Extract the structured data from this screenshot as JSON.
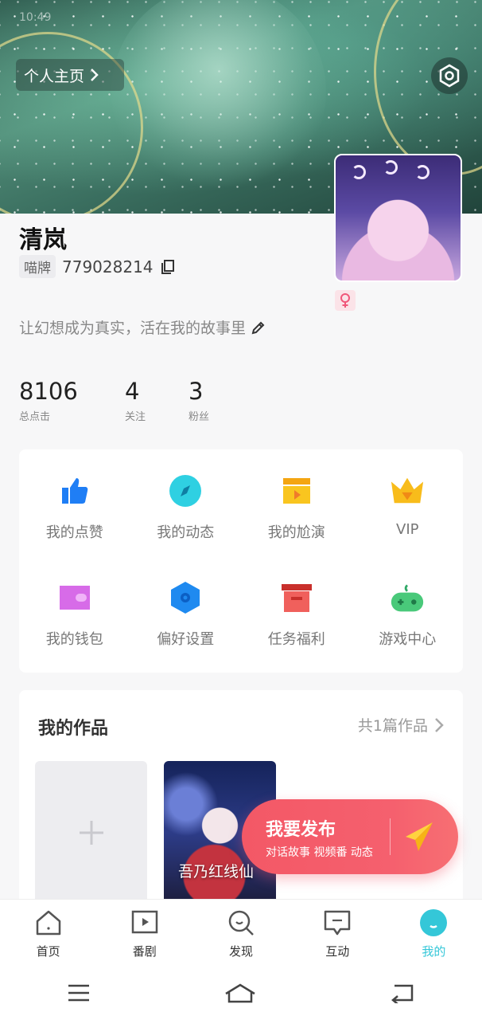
{
  "header": {
    "profile_link_label": "个人主页",
    "status_time": "10:49"
  },
  "user": {
    "name": "清岚",
    "id_tag": "喵牌",
    "id_number": "779028214",
    "bio": "让幻想成为真实，活在我的故事里",
    "gender": "female"
  },
  "stats": [
    {
      "value": "8106",
      "label": "总点击"
    },
    {
      "value": "4",
      "label": "关注"
    },
    {
      "value": "3",
      "label": "粉丝"
    }
  ],
  "menu": [
    {
      "label": "我的点赞",
      "icon": "thumbs-up-icon",
      "color": "#1f7ef5"
    },
    {
      "label": "我的动态",
      "icon": "compass-icon",
      "color": "#2fd0e2"
    },
    {
      "label": "我的尬演",
      "icon": "clapperboard-icon",
      "color": "#f9c51f"
    },
    {
      "label": "VIP",
      "icon": "crown-icon",
      "color": "#f8bc1b"
    },
    {
      "label": "我的钱包",
      "icon": "wallet-icon",
      "color": "#d76be8"
    },
    {
      "label": "偏好设置",
      "icon": "hexagon-settings-icon",
      "color": "#1f8af0"
    },
    {
      "label": "任务福利",
      "icon": "gift-box-icon",
      "color": "#f0605c"
    },
    {
      "label": "游戏中心",
      "icon": "gamepad-icon",
      "color": "#49c97a"
    }
  ],
  "works": {
    "title": "我的作品",
    "count_label": "共1篇作品",
    "items": [
      {
        "title": "吾乃红线仙"
      }
    ]
  },
  "publish": {
    "title": "我要发布",
    "subtitle": "对话故事 视频番 动态"
  },
  "nav": [
    {
      "label": "首页",
      "icon": "home-icon",
      "active": false
    },
    {
      "label": "番剧",
      "icon": "play-icon",
      "active": false
    },
    {
      "label": "发现",
      "icon": "search-icon",
      "active": false
    },
    {
      "label": "互动",
      "icon": "chat-icon",
      "active": false
    },
    {
      "label": "我的",
      "icon": "profile-icon",
      "active": true
    }
  ],
  "colors": {
    "accent": "#34c7d8",
    "publish": "#f35866"
  }
}
